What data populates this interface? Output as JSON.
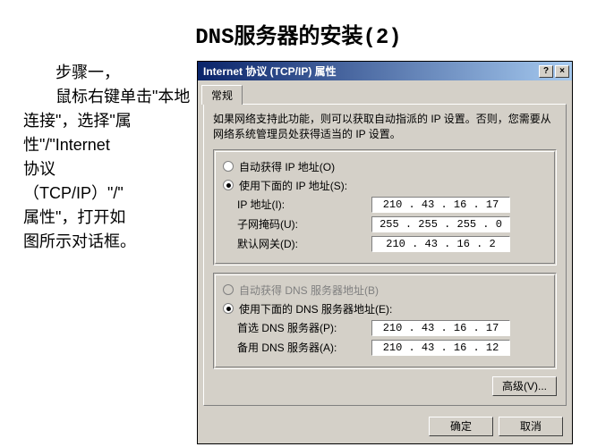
{
  "slide": {
    "title": "DNS服务器的安装(2)",
    "left_text": "　　步骤一，\n　　鼠标右键单击\"本地连接\"，选择\"属性\"/\"Internet协议（TCP/IP）\"/\"属性\"，打开如图所示对话框。"
  },
  "dialog": {
    "title": "Internet 协议 (TCP/IP) 属性",
    "help_btn": "?",
    "close_btn": "×",
    "tab_general": "常规",
    "description": "如果网络支持此功能，则可以获取自动指派的 IP 设置。否则，您需要从网络系统管理员处获得适当的 IP 设置。",
    "radio_auto_ip": "自动获得 IP 地址(O)",
    "radio_use_ip": "使用下面的 IP 地址(S):",
    "label_ip": "IP 地址(I):",
    "value_ip": "210 . 43 . 16 . 17",
    "label_mask": "子网掩码(U):",
    "value_mask": "255 . 255 . 255 .  0",
    "label_gateway": "默认网关(D):",
    "value_gateway": "210 . 43 . 16 .  2",
    "radio_auto_dns": "自动获得 DNS 服务器地址(B)",
    "radio_use_dns": "使用下面的 DNS 服务器地址(E):",
    "label_dns1": "首选 DNS 服务器(P):",
    "value_dns1": "210 . 43 . 16 . 17",
    "label_dns2": "备用 DNS 服务器(A):",
    "value_dns2": "210 . 43 . 16 . 12",
    "btn_advanced": "高级(V)...",
    "btn_ok": "确定",
    "btn_cancel": "取消"
  }
}
